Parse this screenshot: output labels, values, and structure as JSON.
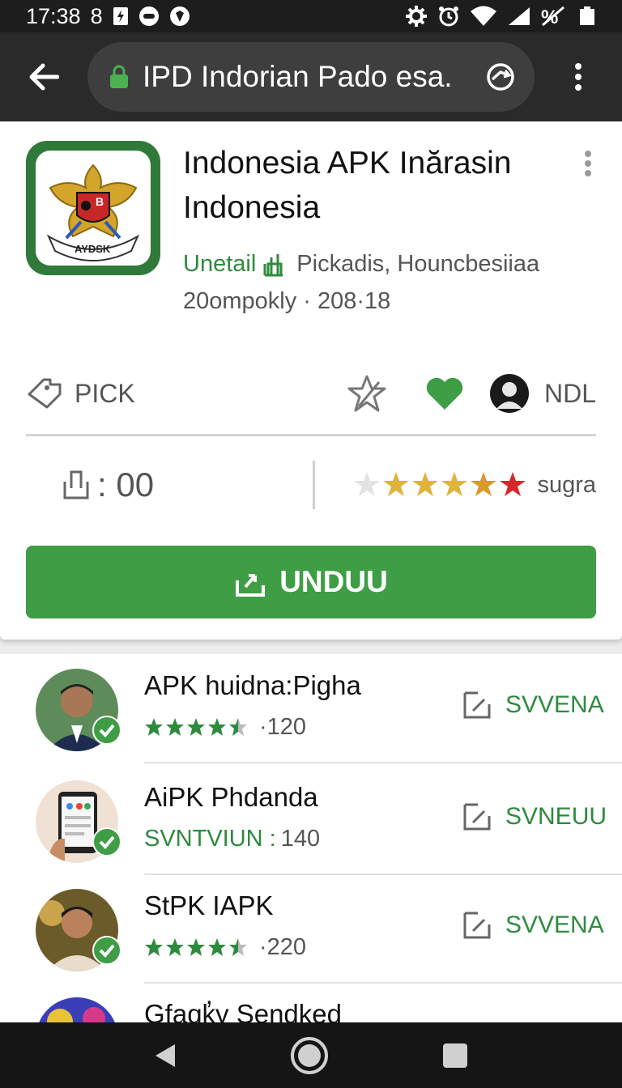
{
  "status_bar": {
    "time": "17:38",
    "left_number": "8",
    "right_icons": [
      "settings-icon",
      "alarm-icon",
      "wifi-icon",
      "signal-icon",
      "battery-icon"
    ]
  },
  "browser": {
    "url": "IPD Indorian Pado esa.",
    "icons": [
      "back-arrow-icon",
      "lock-icon",
      "sync-icon",
      "overflow-menu-icon"
    ]
  },
  "app": {
    "title": "Indonesia APK Inărasin Indonesia",
    "developer": "Unetail",
    "category": "Pickadis, Houncbesiiaa",
    "date": "20ompokly · 208·18",
    "icon_label": "AYDSK",
    "pick_label": "PICK",
    "ndl_label": "NDL",
    "count_label": ": 00",
    "rating_label": "sugra",
    "download_label": "UNDUU",
    "colors": {
      "accent": "#3e9d45",
      "star": "#e0a82e",
      "heart": "#3e9d45"
    }
  },
  "list": {
    "items": [
      {
        "title": "APK huidna:Pigha",
        "sub_prefix": "",
        "sub_value": "120",
        "stars": 4.5,
        "action": "SVVENA",
        "avatar": "person-avatar"
      },
      {
        "title": "AiPK Phdanda",
        "sub_prefix": "SVNTVIUN :",
        "sub_value": "140",
        "stars": 0,
        "action": "SVNEUU",
        "avatar": "phone-avatar"
      },
      {
        "title": "StPK IAPK",
        "sub_prefix": "",
        "sub_value": "220",
        "stars": 4.5,
        "action": "SVVENA",
        "avatar": "person-avatar"
      },
      {
        "title": "Gfaqk̓y Sendked",
        "sub_prefix": "",
        "sub_value": "",
        "stars": 0,
        "action": "",
        "avatar": "colorful-avatar"
      }
    ]
  },
  "nav": {
    "icons": [
      "back-triangle-icon",
      "home-circle-icon",
      "recents-square-icon"
    ]
  }
}
